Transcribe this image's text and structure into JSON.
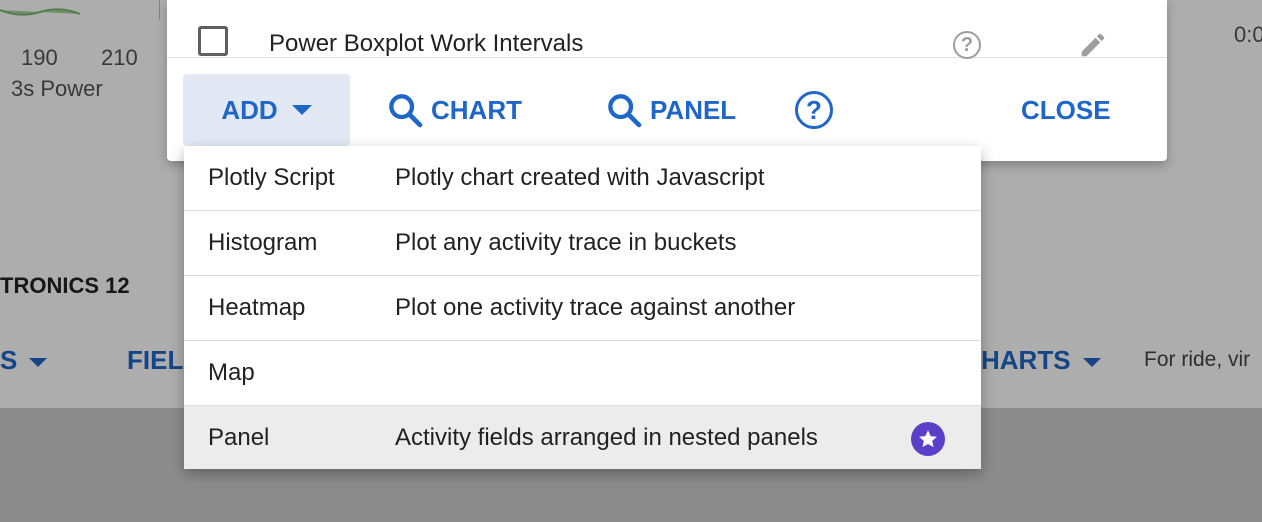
{
  "background": {
    "axis_ticks": [
      "190",
      "210"
    ],
    "axis_label": "3s Power",
    "section_title": "TRONICS 12",
    "tab_left_fragment": "S",
    "tab_fields_fragment": "FIEL",
    "tab_charts_fragment": "HARTS",
    "note_text": "For ride, vir",
    "right_edge_text": "0:0"
  },
  "dialog": {
    "top_row": {
      "label": "Power Boxplot Work Intervals",
      "help_icon": "help-circle-icon",
      "edit_icon": "pencil-icon"
    },
    "toolbar": {
      "add_label": "ADD",
      "chart_label": "CHART",
      "panel_label": "PANEL",
      "help_glyph": "?",
      "close_label": "CLOSE"
    },
    "accent_color": "#1e66c8"
  },
  "menu": {
    "items": [
      {
        "name": "Plotly Script",
        "desc": "Plotly chart created with Javascript"
      },
      {
        "name": "Histogram",
        "desc": "Plot any activity trace in buckets"
      },
      {
        "name": "Heatmap",
        "desc": "Plot one activity trace against another"
      },
      {
        "name": "Map",
        "desc": ""
      },
      {
        "name": "Panel",
        "desc": "Activity fields arranged in nested panels",
        "badge": "star-icon",
        "badge_color": "#5b3fc9"
      }
    ]
  }
}
